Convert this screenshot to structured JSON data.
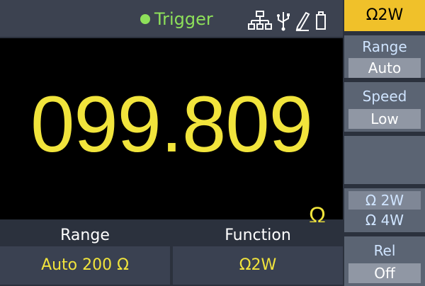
{
  "status": {
    "trigger_label": "Trigger",
    "trigger_color": "#8ee05a",
    "icons": [
      "network-icon",
      "usb-icon",
      "edit-icon",
      "memory-icon"
    ]
  },
  "reading": {
    "value": "099.809",
    "unit": "Ω",
    "color": "#f1e43c"
  },
  "info": {
    "range_label": "Range",
    "range_value": "Auto 200 Ω",
    "function_label": "Function",
    "function_value": "Ω2W"
  },
  "softkeys": {
    "mode": "Ω2W",
    "range": {
      "title": "Range",
      "value": "Auto"
    },
    "speed": {
      "title": "Speed",
      "value": "Low"
    },
    "wire": {
      "option_2w": "Ω 2W",
      "option_4w": "Ω 4W",
      "selected": "Ω 2W"
    },
    "rel": {
      "title": "Rel",
      "value": "Off"
    }
  },
  "colors": {
    "accent": "#f0c12a",
    "softkey_bg": "#5b6473",
    "reading_bg": "#000000"
  }
}
